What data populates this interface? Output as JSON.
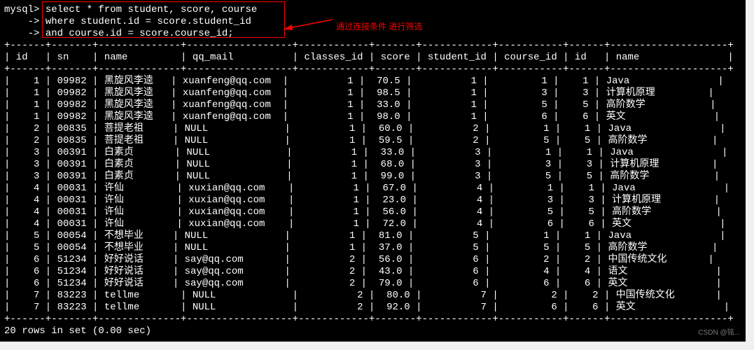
{
  "prompt": "mysql>",
  "cont": "    ->",
  "query": {
    "l1": " select * from student, score, course",
    "l2": " where student.id = score.student_id",
    "l3": " and course.id = score.course_id;"
  },
  "annotation": "通过连接条件 进行筛选",
  "sep": "+------+-------+--------------+------------------+------------+-------+------------+-----------+------+--------------------+",
  "head": "| id   | sn    | name         | qq_mail          | classes_id | score | student_id | course_id | id   | name               |",
  "chart_data": {
    "type": "table",
    "columns": [
      "id",
      "sn",
      "name",
      "qq_mail",
      "classes_id",
      "score",
      "student_id",
      "course_id",
      "id",
      "name"
    ],
    "rows": [
      [
        1,
        "09982",
        "黑旋风李逵",
        "xuanfeng@qq.com",
        1,
        "70.5",
        1,
        1,
        1,
        "Java"
      ],
      [
        1,
        "09982",
        "黑旋风李逵",
        "xuanfeng@qq.com",
        1,
        "98.5",
        1,
        3,
        3,
        "计算机原理"
      ],
      [
        1,
        "09982",
        "黑旋风李逵",
        "xuanfeng@qq.com",
        1,
        "33.0",
        1,
        5,
        5,
        "高阶数学"
      ],
      [
        1,
        "09982",
        "黑旋风李逵",
        "xuanfeng@qq.com",
        1,
        "98.0",
        1,
        6,
        6,
        "英文"
      ],
      [
        2,
        "00835",
        "菩提老祖",
        "NULL",
        1,
        "60.0",
        2,
        1,
        1,
        "Java"
      ],
      [
        2,
        "00835",
        "菩提老祖",
        "NULL",
        1,
        "59.5",
        2,
        5,
        5,
        "高阶数学"
      ],
      [
        3,
        "00391",
        "白素贞",
        "NULL",
        1,
        "33.0",
        3,
        1,
        1,
        "Java"
      ],
      [
        3,
        "00391",
        "白素贞",
        "NULL",
        1,
        "68.0",
        3,
        3,
        3,
        "计算机原理"
      ],
      [
        3,
        "00391",
        "白素贞",
        "NULL",
        1,
        "99.0",
        3,
        5,
        5,
        "高阶数学"
      ],
      [
        4,
        "00031",
        "许仙",
        "xuxian@qq.com",
        1,
        "67.0",
        4,
        1,
        1,
        "Java"
      ],
      [
        4,
        "00031",
        "许仙",
        "xuxian@qq.com",
        1,
        "23.0",
        4,
        3,
        3,
        "计算机原理"
      ],
      [
        4,
        "00031",
        "许仙",
        "xuxian@qq.com",
        1,
        "56.0",
        4,
        5,
        5,
        "高阶数学"
      ],
      [
        4,
        "00031",
        "许仙",
        "xuxian@qq.com",
        1,
        "72.0",
        4,
        6,
        6,
        "英文"
      ],
      [
        5,
        "00054",
        "不想毕业",
        "NULL",
        1,
        "81.0",
        5,
        1,
        1,
        "Java"
      ],
      [
        5,
        "00054",
        "不想毕业",
        "NULL",
        1,
        "37.0",
        5,
        5,
        5,
        "高阶数学"
      ],
      [
        6,
        "51234",
        "好好说话",
        "say@qq.com",
        2,
        "56.0",
        6,
        2,
        2,
        "中国传统文化"
      ],
      [
        6,
        "51234",
        "好好说话",
        "say@qq.com",
        2,
        "43.0",
        6,
        4,
        4,
        "语文"
      ],
      [
        6,
        "51234",
        "好好说话",
        "say@qq.com",
        2,
        "79.0",
        6,
        6,
        6,
        "英文"
      ],
      [
        7,
        "83223",
        "tellme",
        "NULL",
        2,
        "80.0",
        7,
        2,
        2,
        "中国传统文化"
      ],
      [
        7,
        "83223",
        "tellme",
        "NULL",
        2,
        "92.0",
        7,
        6,
        6,
        "英文"
      ]
    ]
  },
  "footer": "20 rows in set (0.00 sec)",
  "watermark": "CSDN @铭..."
}
